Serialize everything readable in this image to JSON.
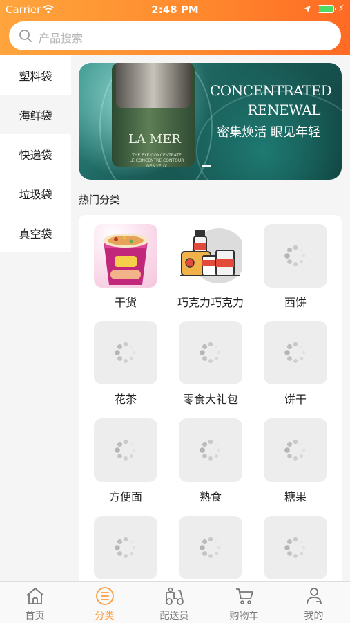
{
  "status_bar": {
    "carrier": "Carrier",
    "time": "2:48 PM",
    "icons": [
      "wifi-icon",
      "location-icon",
      "battery-icon",
      "charging-icon"
    ]
  },
  "search": {
    "placeholder": "产品搜索",
    "icon": "search-icon"
  },
  "sidebar": {
    "items": [
      {
        "label": "塑料袋",
        "selected": false
      },
      {
        "label": "海鲜袋",
        "selected": true
      },
      {
        "label": "快递袋",
        "selected": false
      },
      {
        "label": "垃圾袋",
        "selected": false
      },
      {
        "label": "真空袋",
        "selected": false
      }
    ]
  },
  "banner": {
    "brand": "LA MER",
    "product_line_1": "THE EYE CONCENTRATE",
    "product_line_2": "LE CONCENTRE CONTOUR DES YEUX",
    "headline_line_1": "CONCENTRATED",
    "headline_line_2": "RENEWAL",
    "tagline": "密集焕活 眼见年轻",
    "slide_indicator_active": 0
  },
  "section": {
    "title": "热门分类"
  },
  "categories": [
    {
      "label": "干货",
      "image": "instant-noodle-cup"
    },
    {
      "label": "巧克力巧克力",
      "image": "groceries-illustration"
    },
    {
      "label": "西饼",
      "image": "loading"
    },
    {
      "label": "花茶",
      "image": "loading"
    },
    {
      "label": "零食大礼包",
      "image": "loading"
    },
    {
      "label": "饼干",
      "image": "loading"
    },
    {
      "label": "方便面",
      "image": "loading"
    },
    {
      "label": "熟食",
      "image": "loading"
    },
    {
      "label": "糖果",
      "image": "loading"
    },
    {
      "label": "",
      "image": "loading"
    },
    {
      "label": "",
      "image": "loading"
    },
    {
      "label": "",
      "image": "loading"
    }
  ],
  "tabbar": {
    "items": [
      {
        "label": "首页",
        "icon": "home-icon",
        "active": false
      },
      {
        "label": "分类",
        "icon": "category-icon",
        "active": true
      },
      {
        "label": "配送员",
        "icon": "delivery-scooter-icon",
        "active": false
      },
      {
        "label": "购物车",
        "icon": "cart-icon",
        "active": false
      },
      {
        "label": "我的",
        "icon": "profile-icon",
        "active": false
      }
    ]
  },
  "colors": {
    "accent": "#ff9a3a",
    "header_start": "#ffa53d",
    "header_end": "#ff6a24",
    "battery": "#4cd964"
  }
}
